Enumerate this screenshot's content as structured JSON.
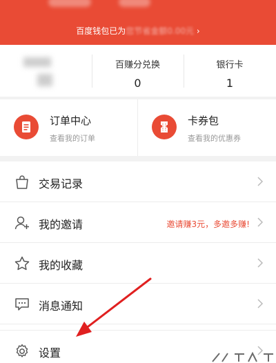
{
  "header": {
    "wallet_text_visible": "百度钱包已为",
    "wallet_text_obscured": "您节省金额",
    "wallet_text_end": "0.00元",
    "chevron": "›"
  },
  "stats": {
    "points": {
      "label": "百赚分兑换",
      "value": "0"
    },
    "bank": {
      "label": "银行卡",
      "value": "1"
    }
  },
  "cards": [
    {
      "title": "订单中心",
      "subtitle": "查看我的订单",
      "icon": "document-icon"
    },
    {
      "title": "卡券包",
      "subtitle": "查看我的优惠券",
      "icon": "ticket-icon"
    }
  ],
  "menu": [
    {
      "label": "交易记录",
      "icon": "shopping-bag-icon",
      "note": ""
    },
    {
      "label": "我的邀请",
      "icon": "invite-user-icon",
      "note": "邀请赚3元，多邀多赚!"
    },
    {
      "label": "我的收藏",
      "icon": "star-icon",
      "note": ""
    },
    {
      "label": "消息通知",
      "icon": "message-icon",
      "note": ""
    },
    {
      "label": "设置",
      "icon": "gear-icon",
      "note": ""
    }
  ],
  "colors": {
    "brand": "#e94b35",
    "annotation": "#e02020"
  }
}
